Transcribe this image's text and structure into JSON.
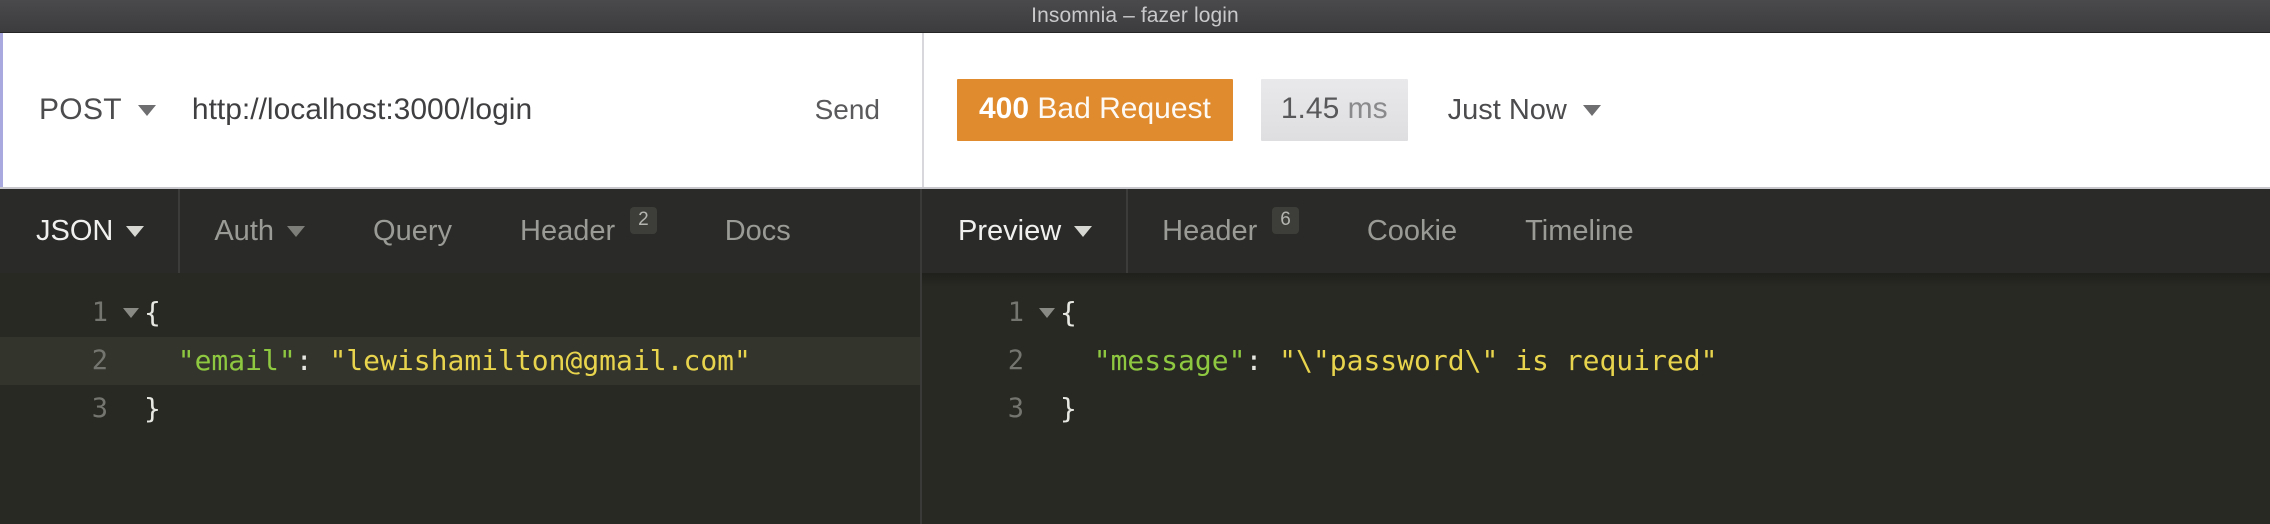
{
  "window": {
    "title": "Insomnia – fazer login"
  },
  "request_bar": {
    "method": "POST",
    "method_caret_icon": "chevron-down-icon",
    "url": "http://localhost:3000/login",
    "send_label": "Send"
  },
  "response_bar": {
    "status_code": "400",
    "status_text": "Bad Request",
    "status_color": "#e08b2e",
    "elapsed_value": "1.45",
    "elapsed_unit": "ms",
    "timestamp_label": "Just Now",
    "timestamp_caret_icon": "chevron-down-icon"
  },
  "request_pane": {
    "tabs": [
      {
        "label": "JSON",
        "active": true,
        "caret": true,
        "badge": ""
      },
      {
        "label": "Auth",
        "active": false,
        "caret": true,
        "badge": ""
      },
      {
        "label": "Query",
        "active": false,
        "caret": false,
        "badge": ""
      },
      {
        "label": "Header",
        "active": false,
        "caret": false,
        "badge": "2"
      },
      {
        "label": "Docs",
        "active": false,
        "caret": false,
        "badge": ""
      }
    ],
    "editor": {
      "language": "json",
      "lines": [
        {
          "number": "1",
          "foldable": true,
          "highlight": false,
          "tokens": [
            {
              "t": "punct",
              "v": "{"
            }
          ]
        },
        {
          "number": "2",
          "foldable": false,
          "highlight": true,
          "tokens": [
            {
              "t": "plain",
              "v": "  "
            },
            {
              "t": "key",
              "v": "\"email\""
            },
            {
              "t": "punct",
              "v": ": "
            },
            {
              "t": "str",
              "v": "\"lewishamilton@gmail.com\""
            }
          ]
        },
        {
          "number": "3",
          "foldable": false,
          "highlight": false,
          "tokens": [
            {
              "t": "punct",
              "v": "}"
            }
          ]
        }
      ]
    }
  },
  "response_pane": {
    "tabs": [
      {
        "label": "Preview",
        "active": true,
        "caret": true,
        "badge": ""
      },
      {
        "label": "Header",
        "active": false,
        "caret": false,
        "badge": "6"
      },
      {
        "label": "Cookie",
        "active": false,
        "caret": false,
        "badge": ""
      },
      {
        "label": "Timeline",
        "active": false,
        "caret": false,
        "badge": ""
      }
    ],
    "editor": {
      "language": "json",
      "lines": [
        {
          "number": "1",
          "foldable": true,
          "highlight": false,
          "tokens": [
            {
              "t": "punct",
              "v": "{"
            }
          ]
        },
        {
          "number": "2",
          "foldable": false,
          "highlight": false,
          "tokens": [
            {
              "t": "plain",
              "v": "  "
            },
            {
              "t": "key",
              "v": "\"message\""
            },
            {
              "t": "punct",
              "v": ": "
            },
            {
              "t": "str",
              "v": "\"\\\"password\\\" is required\""
            }
          ]
        },
        {
          "number": "3",
          "foldable": false,
          "highlight": false,
          "tokens": [
            {
              "t": "punct",
              "v": "}"
            }
          ]
        }
      ]
    }
  }
}
